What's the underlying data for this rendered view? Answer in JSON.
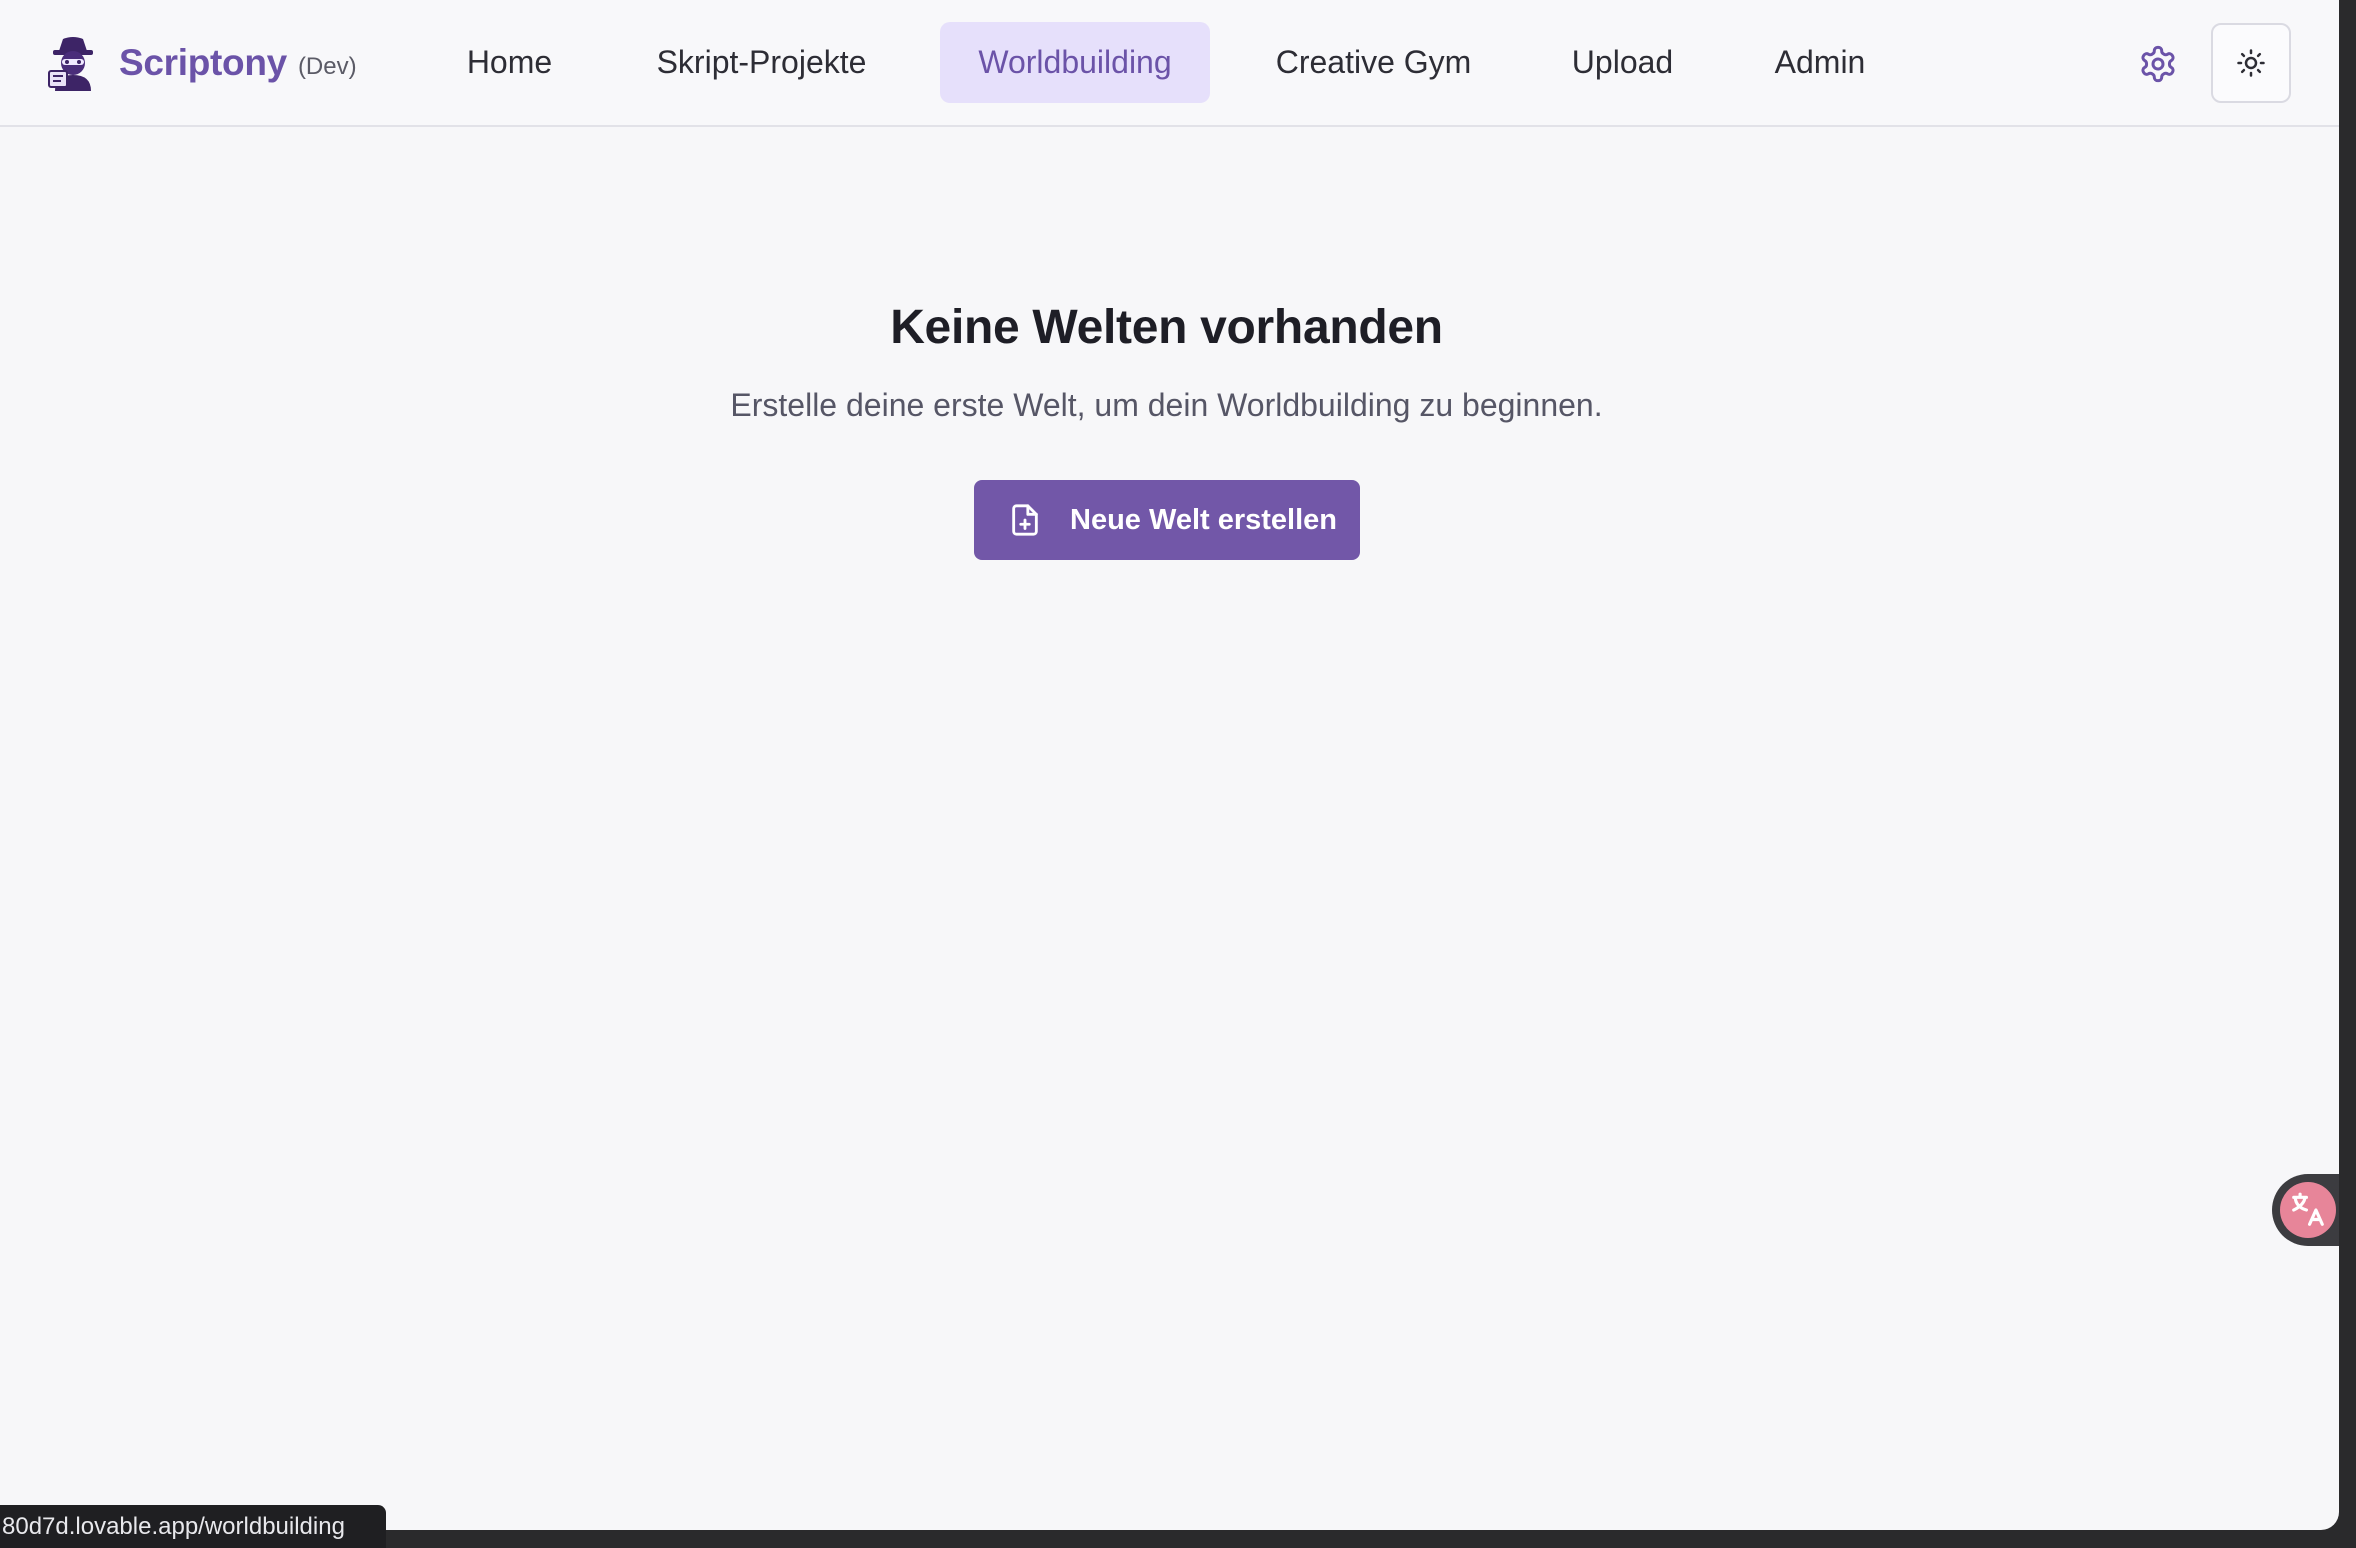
{
  "app": {
    "brand": "Scriptony",
    "env_tag": "(Dev)",
    "logo_icon": "detective-mascot-icon"
  },
  "nav": {
    "items": [
      {
        "label": "Home",
        "active": false
      },
      {
        "label": "Skript-Projekte",
        "active": false
      },
      {
        "label": "Worldbuilding",
        "active": true
      },
      {
        "label": "Creative Gym",
        "active": false
      },
      {
        "label": "Upload",
        "active": false
      },
      {
        "label": "Admin",
        "active": false
      }
    ]
  },
  "header_actions": {
    "settings_icon": "gear-icon",
    "theme_icon": "sun-icon"
  },
  "empty_state": {
    "title": "Keine Welten vorhanden",
    "description": "Erstelle deine erste Welt, um dein Worldbuilding zu beginnen.",
    "button_label": "Neue Welt erstellen",
    "button_icon": "file-plus-icon"
  },
  "overlay": {
    "translate_icon": "translate-icon",
    "status_url": "80d7d.lovable.app/worldbuilding"
  },
  "colors": {
    "accent": "#7257a8",
    "brand_text": "#6b53a8",
    "nav_active_bg": "#e6e0fb",
    "page_bg": "#f7f7f9"
  }
}
